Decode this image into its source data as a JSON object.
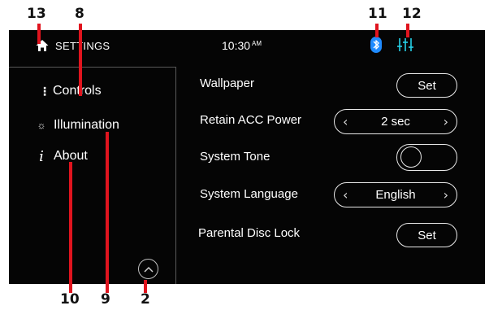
{
  "callouts": {
    "c13": "13",
    "c8": "8",
    "c11": "11",
    "c12": "12",
    "c10": "10",
    "c9": "9",
    "c2": "2"
  },
  "header": {
    "title": "SETTINGS",
    "time": "10:30",
    "ampm": "AM",
    "icons": [
      "home-icon",
      "bluetooth-icon",
      "equalizer-icon"
    ]
  },
  "sidebar": {
    "items": [
      {
        "label": "Controls",
        "icon": "menu-dots-icon"
      },
      {
        "label": "Illumination",
        "icon": "sun-icon"
      },
      {
        "label": "About",
        "icon": "info-icon"
      }
    ],
    "scroll_icon": "chevron-up-icon"
  },
  "settings": {
    "wallpaper": {
      "label": "Wallpaper",
      "button": "Set"
    },
    "acc": {
      "label": "Retain ACC Power",
      "value": "2 sec"
    },
    "tone": {
      "label": "System Tone",
      "enabled": false
    },
    "language": {
      "label": "System Language",
      "value": "English"
    },
    "disc": {
      "label": "Parental Disc Lock",
      "button": "Set"
    }
  },
  "colors": {
    "accent": "#1f8bff",
    "eq_icon": "#26d0e8",
    "callout_line": "#e0141e"
  }
}
